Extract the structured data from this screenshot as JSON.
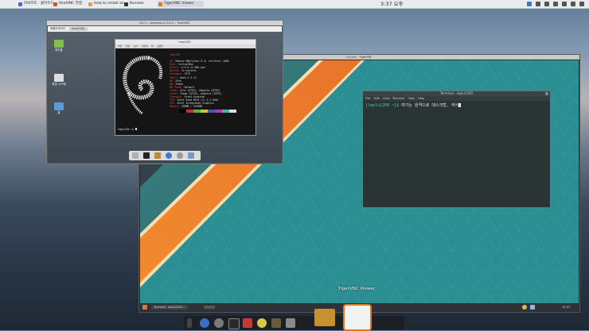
{
  "top_panel": {
    "tasks": [
      {
        "label": "아보카도 : 클라우드"
      },
      {
        "label": "RealVNC 연결"
      },
      {
        "label": "How to install an..."
      },
      {
        "label": "Konsole"
      },
      {
        "label": "TigerVNC Viewer"
      }
    ],
    "clock": "3:37 오후"
  },
  "vm": {
    "title": "b5:1 (...desktop.x1:10:1) - TigerVNC",
    "desktop_icons": [
      {
        "label": "휴지통"
      },
      {
        "label": "파일 시스템"
      },
      {
        "label": "홈"
      }
    ],
    "topbar": {
      "apps_label": "애플리케이션",
      "window_label": "tmp4128_"
    },
    "neofetch": {
      "title": "tmp4128 -",
      "menu": [
        "파일",
        "편집",
        "보기",
        "터미널",
        "탭",
        "도움말"
      ],
      "user_host": "tmp4128",
      "lines": [
        {
          "k": "OS:",
          "v": "Debian GNU/Linux 9.11 (stretch) i686"
        },
        {
          "k": "Host:",
          "v": "VirtualBox"
        },
        {
          "k": "Kernel:",
          "v": "4.9.0-11-686-pae"
        },
        {
          "k": "Uptime:",
          "v": "14 minutes"
        },
        {
          "k": "Packages:",
          "v": "1573"
        },
        {
          "k": "Shell:",
          "v": "bash 4.4.12"
        },
        {
          "k": "DE:",
          "v": "Xfce"
        },
        {
          "k": "WM:",
          "v": "Xfwm4"
        },
        {
          "k": "WM Theme:",
          "v": "Default"
        },
        {
          "k": "Theme:",
          "v": "Xfce [GTK2], Adwaita [GTK3]"
        },
        {
          "k": "Icons:",
          "v": "Tango [GTK2], Adwaita [GTK3]"
        },
        {
          "k": "Terminal:",
          "v": "xfce4-terminal"
        },
        {
          "k": "CPU:",
          "v": "Intel Atom N270 (1) @ 1.6GHz"
        },
        {
          "k": "GPU:",
          "v": "Intel Integrated Graphics"
        },
        {
          "k": "Memory:",
          "v": "209MB / 1019MB"
        }
      ],
      "prompt": "tmp4128:~$"
    }
  },
  "remote": {
    "title": "x11vnc - TigerVNC",
    "terminal": {
      "title": "Terminal - leplu1200",
      "menu": [
        "File",
        "Edit",
        "View",
        "Terminal",
        "Tabs",
        "Help"
      ],
      "prompt": "[leplu1200 ~]$",
      "command": "여기는 원격으로 데스크탑, 켜서"
    },
    "taskbar": {
      "task": "Terminal - leplu1200:~",
      "clock": "15:37"
    }
  },
  "tooltip": "TigerVNC Viewer",
  "colors": {
    "remote_bg": "#2a8e92",
    "stripe_orange": "#ee7a2a",
    "stripe_cream": "#f5dfb2",
    "prompt_green": "#56c7a9"
  }
}
